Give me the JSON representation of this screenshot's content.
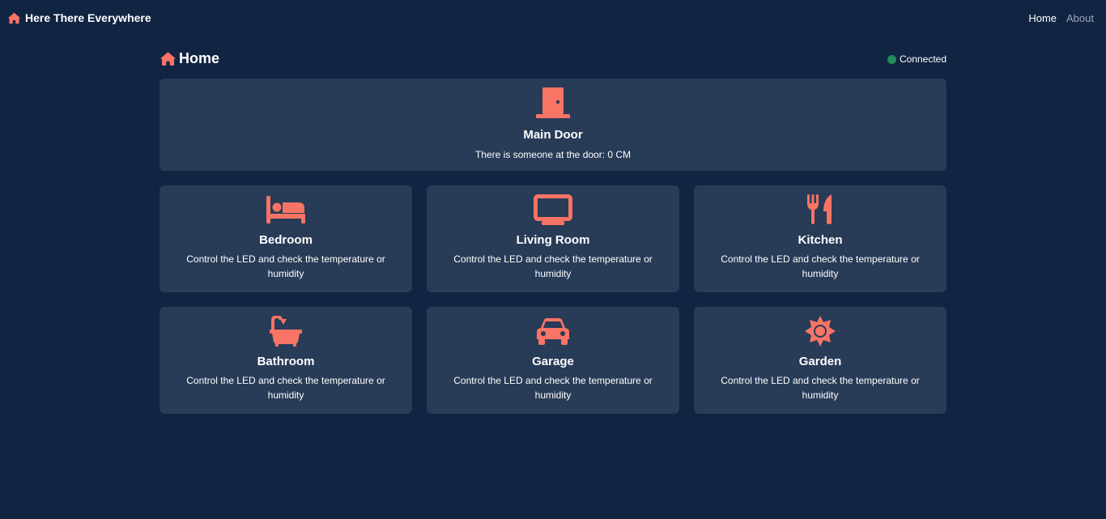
{
  "colors": {
    "background": "#112442",
    "card": "#283b57",
    "accent": "#f87464",
    "status_connected": "#1f8c5a"
  },
  "navbar": {
    "brand_icon": "home-icon",
    "brand": "Here There Everywhere",
    "links": [
      {
        "label": "Home",
        "active": true
      },
      {
        "label": "About",
        "active": false
      }
    ]
  },
  "header": {
    "icon": "home-icon",
    "title": "Home",
    "status": "Connected"
  },
  "door": {
    "icon": "door-icon",
    "title": "Main Door",
    "description": "There is someone at the door: 0 CM"
  },
  "rooms": [
    {
      "icon": "bed-icon",
      "title": "Bedroom",
      "description": "Control the LED and check the temperature or humidity"
    },
    {
      "icon": "tv-icon",
      "title": "Living Room",
      "description": "Control the LED and check the temperature or humidity"
    },
    {
      "icon": "utensils-icon",
      "title": "Kitchen",
      "description": "Control the LED and check the temperature or humidity"
    },
    {
      "icon": "bath-icon",
      "title": "Bathroom",
      "description": "Control the LED and check the temperature or humidity"
    },
    {
      "icon": "car-icon",
      "title": "Garage",
      "description": "Control the LED and check the temperature or humidity"
    },
    {
      "icon": "sun-icon",
      "title": "Garden",
      "description": "Control the LED and check the temperature or humidity"
    }
  ]
}
